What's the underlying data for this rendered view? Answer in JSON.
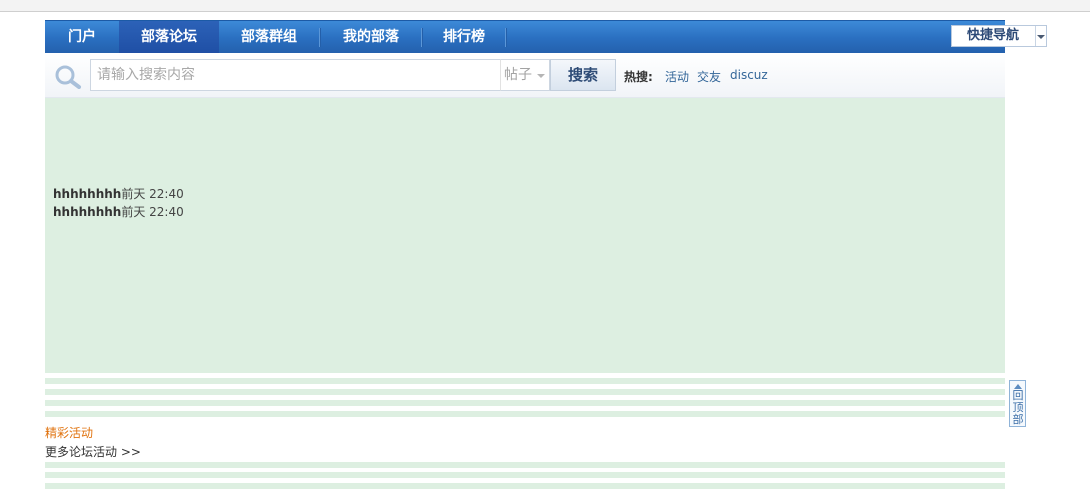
{
  "nav": {
    "items": [
      {
        "label": "门户"
      },
      {
        "label": "部落论坛",
        "active": true
      },
      {
        "label": "部落群组"
      },
      {
        "label": "我的部落"
      },
      {
        "label": "排行榜"
      }
    ],
    "quick_nav_label": "快捷导航"
  },
  "search": {
    "placeholder": "请输入搜索内容",
    "type_label": "帖子",
    "button_label": "搜索",
    "hot_label": "热搜:",
    "hot_links": [
      "活动",
      "交友",
      "discuz"
    ]
  },
  "posts": [
    {
      "user": "hhhhhhhh",
      "time": "前天 22:40"
    },
    {
      "user": "hhhhhhhh",
      "time": "前天 22:40"
    }
  ],
  "activity": {
    "title": "精彩活动",
    "more_label": "更多论坛活动 >>"
  },
  "back_to_top": "回顶部",
  "colors": {
    "nav_blue": "#2a6fc0",
    "content_green": "#ddefe1",
    "activity_orange": "#e0730f",
    "link_blue": "#336699"
  }
}
